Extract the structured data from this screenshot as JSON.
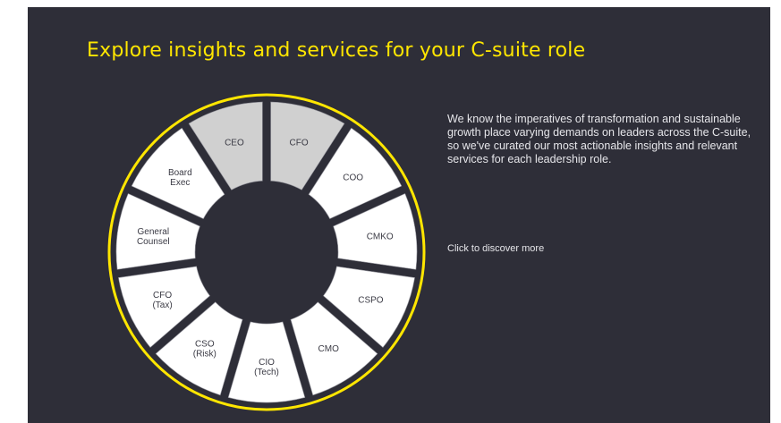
{
  "title": "Explore insights and services for your C-suite role",
  "description": "We know the imperatives of transformation and sustainable growth place varying demands on leaders across the C-suite, so we've curated our most actionable insights and relevant services for each leadership role.",
  "cta": "Click to discover more",
  "colors": {
    "background": "#2e2e38",
    "accent": "#ffe600",
    "segment": "#ffffff",
    "segment_highlight": "#d0d0d0"
  },
  "wheel": {
    "segments": [
      {
        "lines": [
          "CFO"
        ],
        "highlighted": true
      },
      {
        "lines": [
          "COO"
        ],
        "highlighted": false
      },
      {
        "lines": [
          "CMKO"
        ],
        "highlighted": false
      },
      {
        "lines": [
          "CSPO"
        ],
        "highlighted": false
      },
      {
        "lines": [
          "CMO"
        ],
        "highlighted": false
      },
      {
        "lines": [
          "CIO",
          "(Tech)"
        ],
        "highlighted": false
      },
      {
        "lines": [
          "CSO",
          "(Risk)"
        ],
        "highlighted": false
      },
      {
        "lines": [
          "CFO",
          "(Tax)"
        ],
        "highlighted": false
      },
      {
        "lines": [
          "General",
          "Counsel"
        ],
        "highlighted": false
      },
      {
        "lines": [
          "Board",
          "Exec"
        ],
        "highlighted": false
      },
      {
        "lines": [
          "CEO"
        ],
        "highlighted": true
      }
    ]
  }
}
